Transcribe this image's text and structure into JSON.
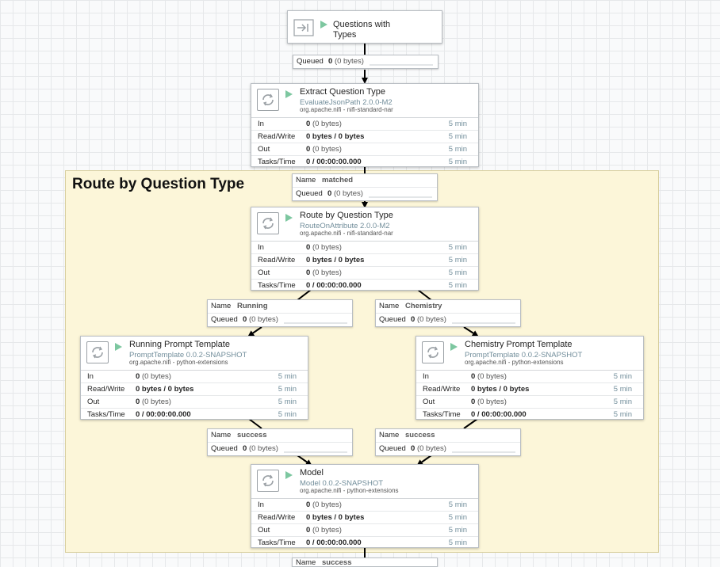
{
  "input_port": {
    "name_line1": "Questions with",
    "name_line2": "Types",
    "icon": "input-port-icon"
  },
  "group": {
    "title": "Route by Question Type"
  },
  "labels": {
    "in": "In",
    "read_write": "Read/Write",
    "out": "Out",
    "tasks_time": "Tasks/Time",
    "name": "Name",
    "queued": "Queued"
  },
  "processors": [
    {
      "name": "Extract Question Type",
      "type": "EvaluateJsonPath 2.0.0-M2",
      "bundle": "org.apache.nifi - nifi-standard-nar",
      "in_count": "0",
      "in_bytes": "(0 bytes)",
      "rw": "0 bytes / 0 bytes",
      "out_count": "0",
      "out_bytes": "(0 bytes)",
      "tasks": "0 / 00:00:00.000",
      "window": "5 min"
    },
    {
      "name": "Route by Question Type",
      "type": "RouteOnAttribute 2.0.0-M2",
      "bundle": "org.apache.nifi - nifi-standard-nar",
      "in_count": "0",
      "in_bytes": "(0 bytes)",
      "rw": "0 bytes / 0 bytes",
      "out_count": "0",
      "out_bytes": "(0 bytes)",
      "tasks": "0 / 00:00:00.000",
      "window": "5 min"
    },
    {
      "name": "Running Prompt Template",
      "type": "PromptTemplate 0.0.2-SNAPSHOT",
      "bundle": "org.apache.nifi - python-extensions",
      "in_count": "0",
      "in_bytes": "(0 bytes)",
      "rw": "0 bytes / 0 bytes",
      "out_count": "0",
      "out_bytes": "(0 bytes)",
      "tasks": "0 / 00:00:00.000",
      "window": "5 min"
    },
    {
      "name": "Chemistry Prompt Template",
      "type": "PromptTemplate 0.0.2-SNAPSHOT",
      "bundle": "org.apache.nifi - python-extensions",
      "in_count": "0",
      "in_bytes": "(0 bytes)",
      "rw": "0 bytes / 0 bytes",
      "out_count": "0",
      "out_bytes": "(0 bytes)",
      "tasks": "0 / 00:00:00.000",
      "window": "5 min"
    },
    {
      "name": "Model",
      "type": "Model 0.0.2-SNAPSHOT",
      "bundle": "org.apache.nifi - python-extensions",
      "in_count": "0",
      "in_bytes": "(0 bytes)",
      "rw": "0 bytes / 0 bytes",
      "out_count": "0",
      "out_bytes": "(0 bytes)",
      "tasks": "0 / 00:00:00.000",
      "window": "5 min"
    }
  ],
  "connections": [
    {
      "name": "",
      "queued_count": "0",
      "queued_bytes": "(0 bytes)"
    },
    {
      "name": "matched",
      "queued_count": "0",
      "queued_bytes": "(0 bytes)"
    },
    {
      "name": "Running",
      "queued_count": "0",
      "queued_bytes": "(0 bytes)"
    },
    {
      "name": "Chemistry",
      "queued_count": "0",
      "queued_bytes": "(0 bytes)"
    },
    {
      "name": "success",
      "queued_count": "0",
      "queued_bytes": "(0 bytes)"
    },
    {
      "name": "success",
      "queued_count": "0",
      "queued_bytes": "(0 bytes)"
    },
    {
      "name": "success",
      "queued_count": "",
      "queued_bytes": ""
    }
  ],
  "colors": {
    "running": "#7dc7a0",
    "group_bg": "#fcf6d9",
    "type_text": "#728e9b"
  }
}
